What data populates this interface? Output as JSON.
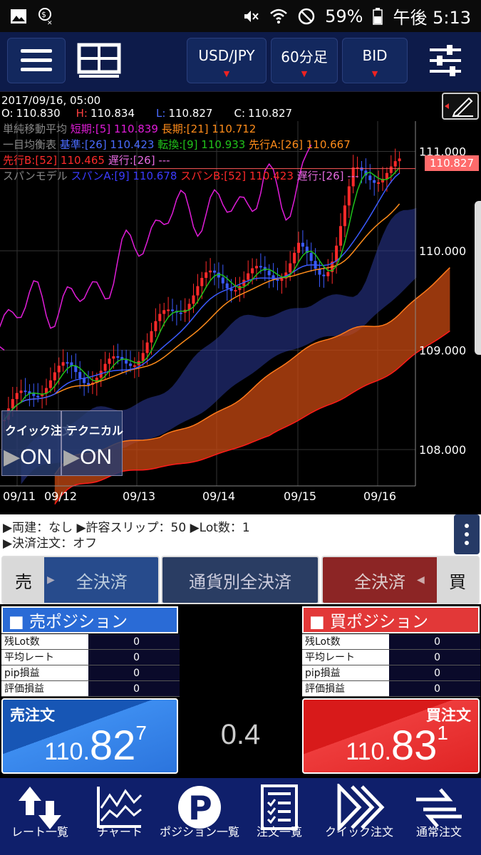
{
  "status_bar": {
    "battery": "59%",
    "time": "午後 5:13"
  },
  "toolbar": {
    "pair": "USD/JPY",
    "timeframe": "60分足",
    "price_type": "BID"
  },
  "chart": {
    "datetime": "2017/09/16, 05:00",
    "ohlc": {
      "o_label": "O:",
      "o": "110.830",
      "h_label": "H:",
      "h": "110.834",
      "l_label": "L:",
      "l": "110.827",
      "c_label": "C:",
      "c": "110.827"
    },
    "legend": {
      "sma": "単純移動平均",
      "sma_short": "短期:[5] 110.839",
      "sma_long": "長期:[21] 110.712",
      "ichimoku": "一目均衡表",
      "kijun": "基準:[26] 110.423",
      "tenkan": "転換:[9] 110.933",
      "senkou_a": "先行A:[26] 110.667",
      "senkou_b": "先行B:[52] 110.465",
      "chikou": "遅行:[26] ---",
      "span": "スパンモデル",
      "span_a": "スパンA:[9] 110.678",
      "span_b": "スパンB:[52] 110.423",
      "span_lag": "遅行:[26] ---"
    },
    "y_ticks": [
      "111.000",
      "110.000",
      "109.000",
      "108.000"
    ],
    "x_ticks": [
      "09/11",
      "09/12",
      "09/13",
      "09/14",
      "09/15",
      "09/16"
    ],
    "current_price": "110.827",
    "quick_order": {
      "label": "クイック注文",
      "state": "ON"
    },
    "technical": {
      "label": "テクニカル",
      "state": "ON"
    },
    "colors": {
      "sma_short": "#e01cd8",
      "sma_long": "#ff8c1a",
      "kijun": "#3b5bff",
      "tenkan": "#21c21a",
      "senkou_a": "#ff7a1a",
      "senkou_b": "#ff1a1a",
      "span_a": "#3b3bff",
      "span_b": "#ff2a2a",
      "price_line": "#ff5a5a"
    }
  },
  "info": {
    "line1": "▶両建：なし ▶許容スリップ：50 ▶Lot数：1",
    "line2": "▶決済注文：オフ"
  },
  "close_bar": {
    "sell": "売",
    "sell_all": "全決済",
    "currency_all": "通貨別全決済",
    "buy_all": "全決済",
    "buy": "買"
  },
  "sell_position": {
    "title": "■ 売ポジション",
    "rows": [
      {
        "k": "残Lot数",
        "v": "0"
      },
      {
        "k": "平均レート",
        "v": "0"
      },
      {
        "k": "pip損益",
        "v": "0"
      },
      {
        "k": "評価損益",
        "v": "0"
      }
    ]
  },
  "buy_position": {
    "title": "■ 買ポジション",
    "rows": [
      {
        "k": "残Lot数",
        "v": "0"
      },
      {
        "k": "平均レート",
        "v": "0"
      },
      {
        "k": "pip損益",
        "v": "0"
      },
      {
        "k": "評価損益",
        "v": "0"
      }
    ]
  },
  "sell_order": {
    "label": "売注文",
    "p1": "110.",
    "p2": "82",
    "p3": "7"
  },
  "buy_order": {
    "label": "買注文",
    "p1": "110.",
    "p2": "83",
    "p3": "1"
  },
  "spread": "0.4",
  "nav": [
    {
      "label": "レート一覧",
      "icon": "rate-list-icon"
    },
    {
      "label": "チャート",
      "icon": "chart-icon"
    },
    {
      "label": "ポジション一覧",
      "icon": "position-list-icon"
    },
    {
      "label": "注文一覧",
      "icon": "order-list-icon"
    },
    {
      "label": "クイック注文",
      "icon": "quick-order-icon"
    },
    {
      "label": "通常注文",
      "icon": "normal-order-icon"
    }
  ]
}
